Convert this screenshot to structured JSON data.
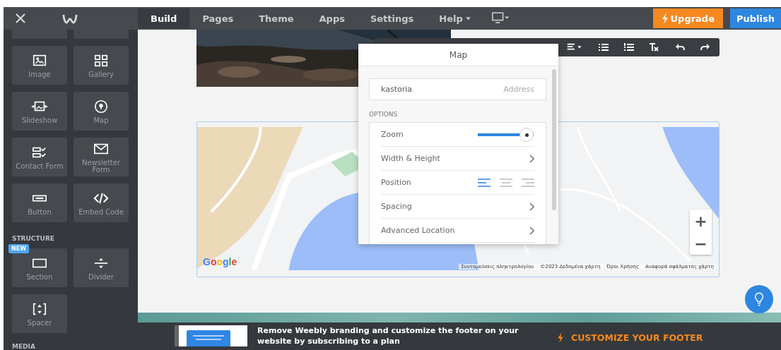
{
  "topbar": {
    "tabs": [
      {
        "label": "Build",
        "selected": true,
        "kind": "tab"
      },
      {
        "label": "Pages",
        "selected": false,
        "kind": "tab"
      },
      {
        "label": "Theme",
        "selected": false,
        "kind": "tab"
      },
      {
        "label": "Apps",
        "selected": false,
        "kind": "tab"
      },
      {
        "label": "Settings",
        "selected": false,
        "kind": "tab"
      },
      {
        "label": "Help",
        "selected": false,
        "kind": "dropdown"
      }
    ],
    "upgrade": "Upgrade",
    "publish": "Publish"
  },
  "sidebar": {
    "elements": [
      {
        "label": "Image"
      },
      {
        "label": "Gallery"
      },
      {
        "label": "Slideshow"
      },
      {
        "label": "Map"
      },
      {
        "label": "Contact Form"
      },
      {
        "label": "Newsletter Form"
      },
      {
        "label": "Button"
      },
      {
        "label": "Embed Code"
      }
    ],
    "structure_title": "STRUCTURE",
    "structure": [
      {
        "label": "Section",
        "badge": "NEW"
      },
      {
        "label": "Divider"
      },
      {
        "label": "Spacer"
      }
    ],
    "media_title": "MEDIA"
  },
  "map_panel": {
    "title": "Map",
    "address": {
      "value": "kastoria",
      "label": "Address"
    },
    "options_title": "OPTIONS",
    "options": [
      {
        "kind": "slider",
        "label": "Zoom",
        "level": 0.88
      },
      {
        "kind": "link",
        "label": "Width & Height"
      },
      {
        "kind": "align",
        "label": "Position",
        "choices": [
          {
            "selected": true
          },
          {
            "selected": false
          },
          {
            "selected": false
          }
        ]
      },
      {
        "kind": "link",
        "label": "Spacing"
      },
      {
        "kind": "link",
        "label": "Advanced Location"
      }
    ]
  },
  "map": {
    "logo": "Google",
    "attribution": [
      "Συντομεύσεις πληκτρολογίου",
      "©2023 Δεδομένα χάρτη",
      "Όροι Χρήσης",
      "Αναφορά σφάλματος χάρτη"
    ],
    "zoom_in": "+",
    "zoom_out": "−"
  },
  "footer": {
    "message": "Remove Weebly branding and customize the footer on your website by subscribing to a plan",
    "action": "CUSTOMIZE YOUR FOOTER"
  }
}
